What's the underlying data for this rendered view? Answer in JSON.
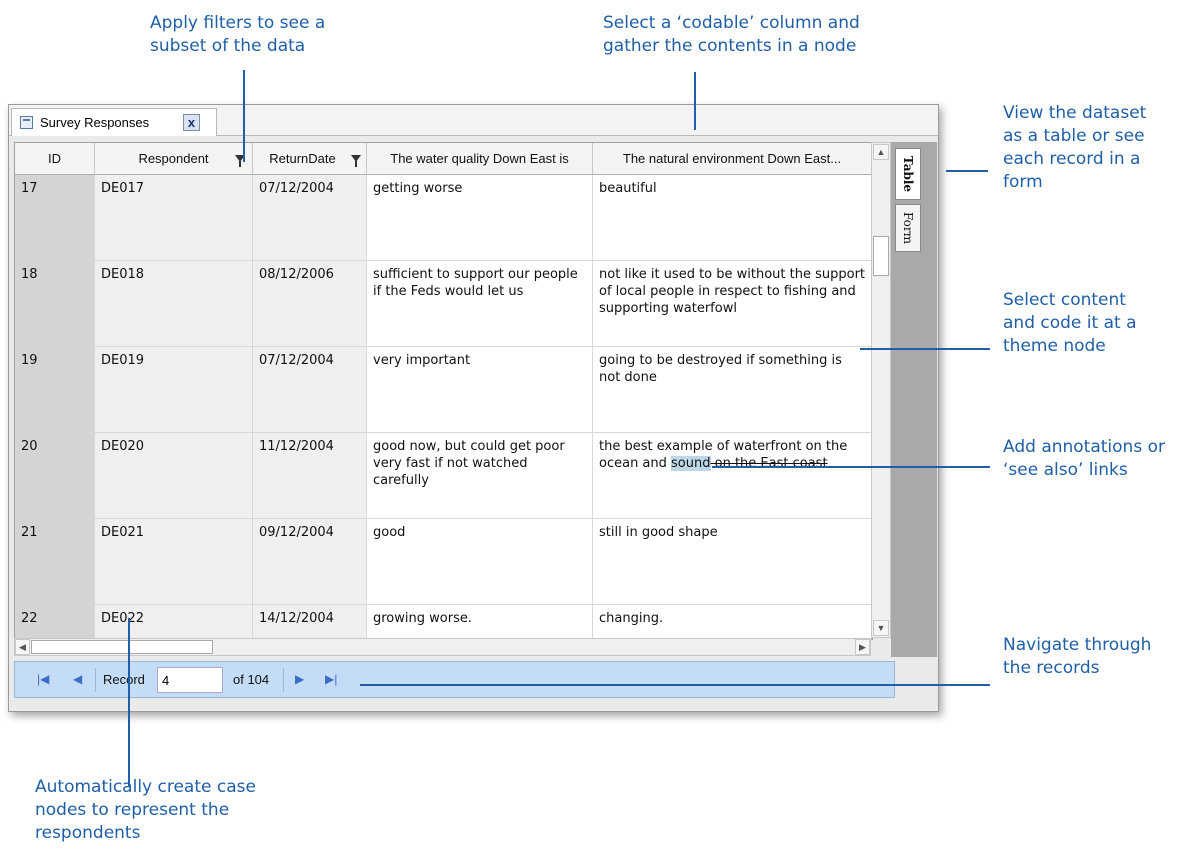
{
  "callouts": {
    "filters": "Apply filters to see a\nsubset of the data",
    "codable": "Select a ‘codable’ column and\ngather the contents in a node",
    "view": "View the dataset\nas a table or see\neach record in a\nform",
    "select_content": "Select content\nand code it at a\ntheme node",
    "annotations": "Add annotations or\n‘see also’ links",
    "navigate": "Navigate through\nthe records",
    "case_nodes": "Automatically create case\nnodes to represent the\nrespondents"
  },
  "document_tab": {
    "title": "Survey Responses",
    "close": "x"
  },
  "table": {
    "columns": [
      "ID",
      "Respondent",
      "ReturnDate",
      "The water quality Down East is",
      "The natural environment Down East..."
    ],
    "rows": [
      {
        "id": "17",
        "respondent": "DE017",
        "date": "07/12/2004",
        "water": "getting worse",
        "nature": "beautiful"
      },
      {
        "id": "18",
        "respondent": "DE018",
        "date": "08/12/2006",
        "water": "sufficient to support our people if the Feds would let us",
        "nature": "not like it used to be without the support of local people in respect to fishing and supporting waterfowl"
      },
      {
        "id": "19",
        "respondent": "DE019",
        "date": "07/12/2004",
        "water": "very important",
        "nature": "going to be destroyed if something is not done"
      },
      {
        "id": "20",
        "respondent": "DE020",
        "date": "11/12/2004",
        "water": "good now, but could get poor very fast if not watched carefully",
        "nature_a": "the best example of waterfront on the ocean and ",
        "nature_hl": "sound",
        "nature_b": " on the East coast"
      },
      {
        "id": "21",
        "respondent": "DE021",
        "date": "09/12/2004",
        "water": "good",
        "nature": "still in good shape"
      },
      {
        "id": "22",
        "respondent": "DE022",
        "date": "14/12/2004",
        "water": "growing worse.",
        "nature": "changing."
      }
    ]
  },
  "side_tabs": {
    "table": "Table",
    "form": "Form"
  },
  "navigator": {
    "record_label": "Record",
    "record_value": "4",
    "of_label": "of 104",
    "first_icon": "first-record-icon",
    "prev_icon": "previous-record-icon",
    "next_icon": "next-record-icon",
    "last_icon": "last-record-icon"
  }
}
